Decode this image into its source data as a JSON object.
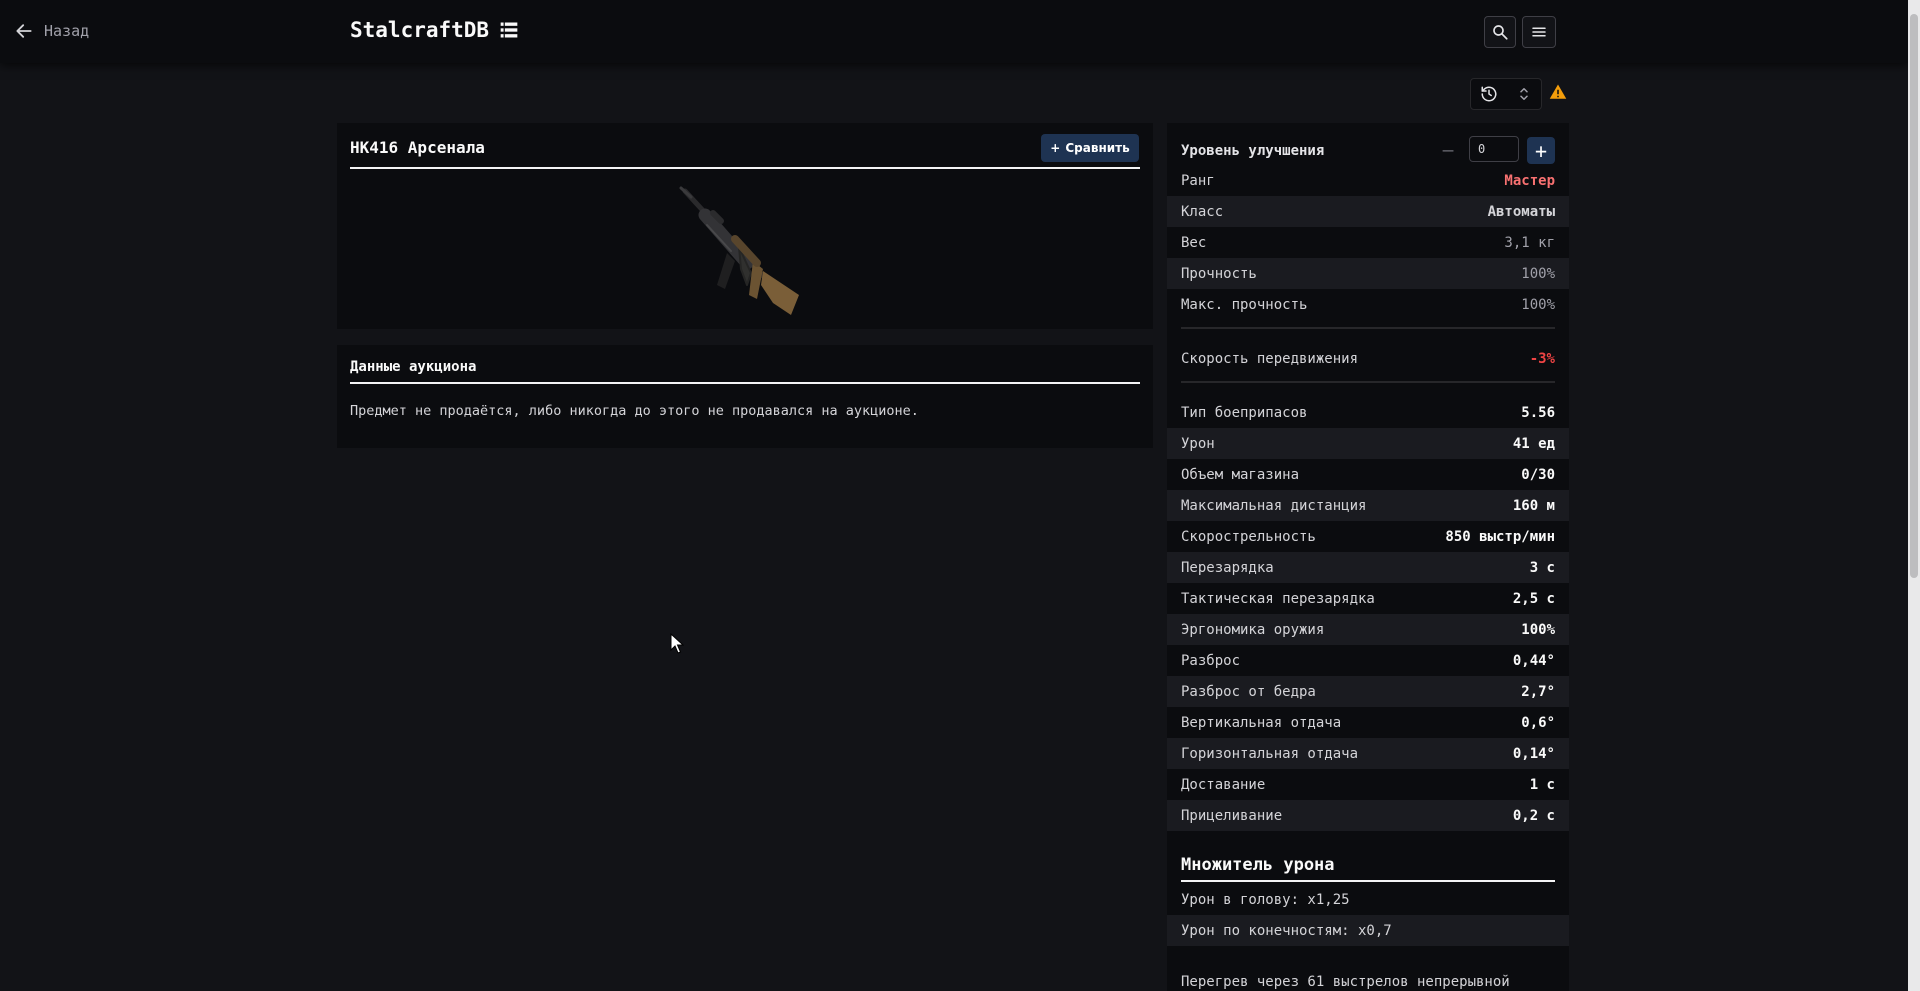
{
  "header": {
    "back_label": "Назад",
    "logo": "StalcraftDB"
  },
  "item": {
    "title": "HK416 Арсенала",
    "compare_label": "Сравнить"
  },
  "auction": {
    "title": "Данные аукциона",
    "text": "Предмет не продаётся, либо никогда до этого не продавался на аукционе."
  },
  "upgrade": {
    "label": "Уровень улучшения",
    "value": "0"
  },
  "stats_basic": [
    {
      "label": "Ранг",
      "value": "Мастер"
    },
    {
      "label": "Класс",
      "value": "Автоматы"
    },
    {
      "label": "Вес",
      "value": "3,1 кг"
    },
    {
      "label": "Прочность",
      "value": "100%"
    },
    {
      "label": "Макс. прочность",
      "value": "100%"
    }
  ],
  "stats_move": {
    "label": "Скорость передвижения",
    "value": "-3%"
  },
  "stats_weapon": [
    {
      "label": "Тип боеприпасов",
      "value": "5.56"
    },
    {
      "label": "Урон",
      "value": "41 ед"
    },
    {
      "label": "Объем магазина",
      "value": "0/30"
    },
    {
      "label": "Максимальная дистанция",
      "value": "160 м"
    },
    {
      "label": "Скорострельность",
      "value": "850 выстр/мин"
    },
    {
      "label": "Перезарядка",
      "value": "3 с"
    },
    {
      "label": "Тактическая перезарядка",
      "value": "2,5 с"
    },
    {
      "label": "Эргономика оружия",
      "value": "100%"
    },
    {
      "label": "Разброс",
      "value": "0,44°"
    },
    {
      "label": "Разброс от бедра",
      "value": "2,7°"
    },
    {
      "label": "Вертикальная отдача",
      "value": "0,6°"
    },
    {
      "label": "Горизонтальная отдача",
      "value": "0,14°"
    },
    {
      "label": "Доставание",
      "value": "1 с"
    },
    {
      "label": "Прицеливание",
      "value": "0,2 с"
    }
  ],
  "multiplier": {
    "title": "Множитель урона",
    "head": "Урон в голову: x1,25",
    "limbs": "Урон по конечностям: x0,7"
  },
  "overheat": "Перегрев через 61 выстрелов непрерывной",
  "colors": {
    "background": "#121317",
    "card": "#0b0c0f",
    "accent": "#1e3352",
    "rank_master": "#f87171",
    "negative": "#ef4444",
    "warning": "#f59e0b"
  }
}
